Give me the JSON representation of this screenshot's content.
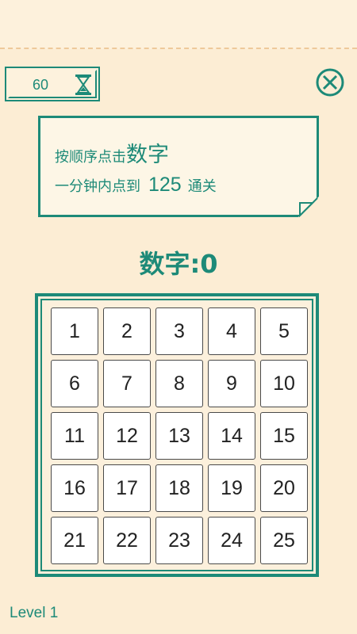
{
  "timer": {
    "value": "60",
    "icon": "hourglass-icon"
  },
  "close": {
    "icon": "close-icon"
  },
  "instruction": {
    "line1_prefix": "按顺序点击",
    "line1_emphasis": "数字",
    "line2_prefix": "一分钟内点到",
    "line2_target": "125",
    "line2_suffix": "通关"
  },
  "score": {
    "text": "数字:0"
  },
  "board": {
    "cells": [
      "1",
      "2",
      "3",
      "4",
      "5",
      "6",
      "7",
      "8",
      "9",
      "10",
      "11",
      "12",
      "13",
      "14",
      "15",
      "16",
      "17",
      "18",
      "19",
      "20",
      "21",
      "22",
      "23",
      "24",
      "25"
    ]
  },
  "level": {
    "text": "Level 1"
  },
  "colors": {
    "accent": "#1d8a78",
    "background": "#fcedd4",
    "cell": "#ffffff"
  }
}
